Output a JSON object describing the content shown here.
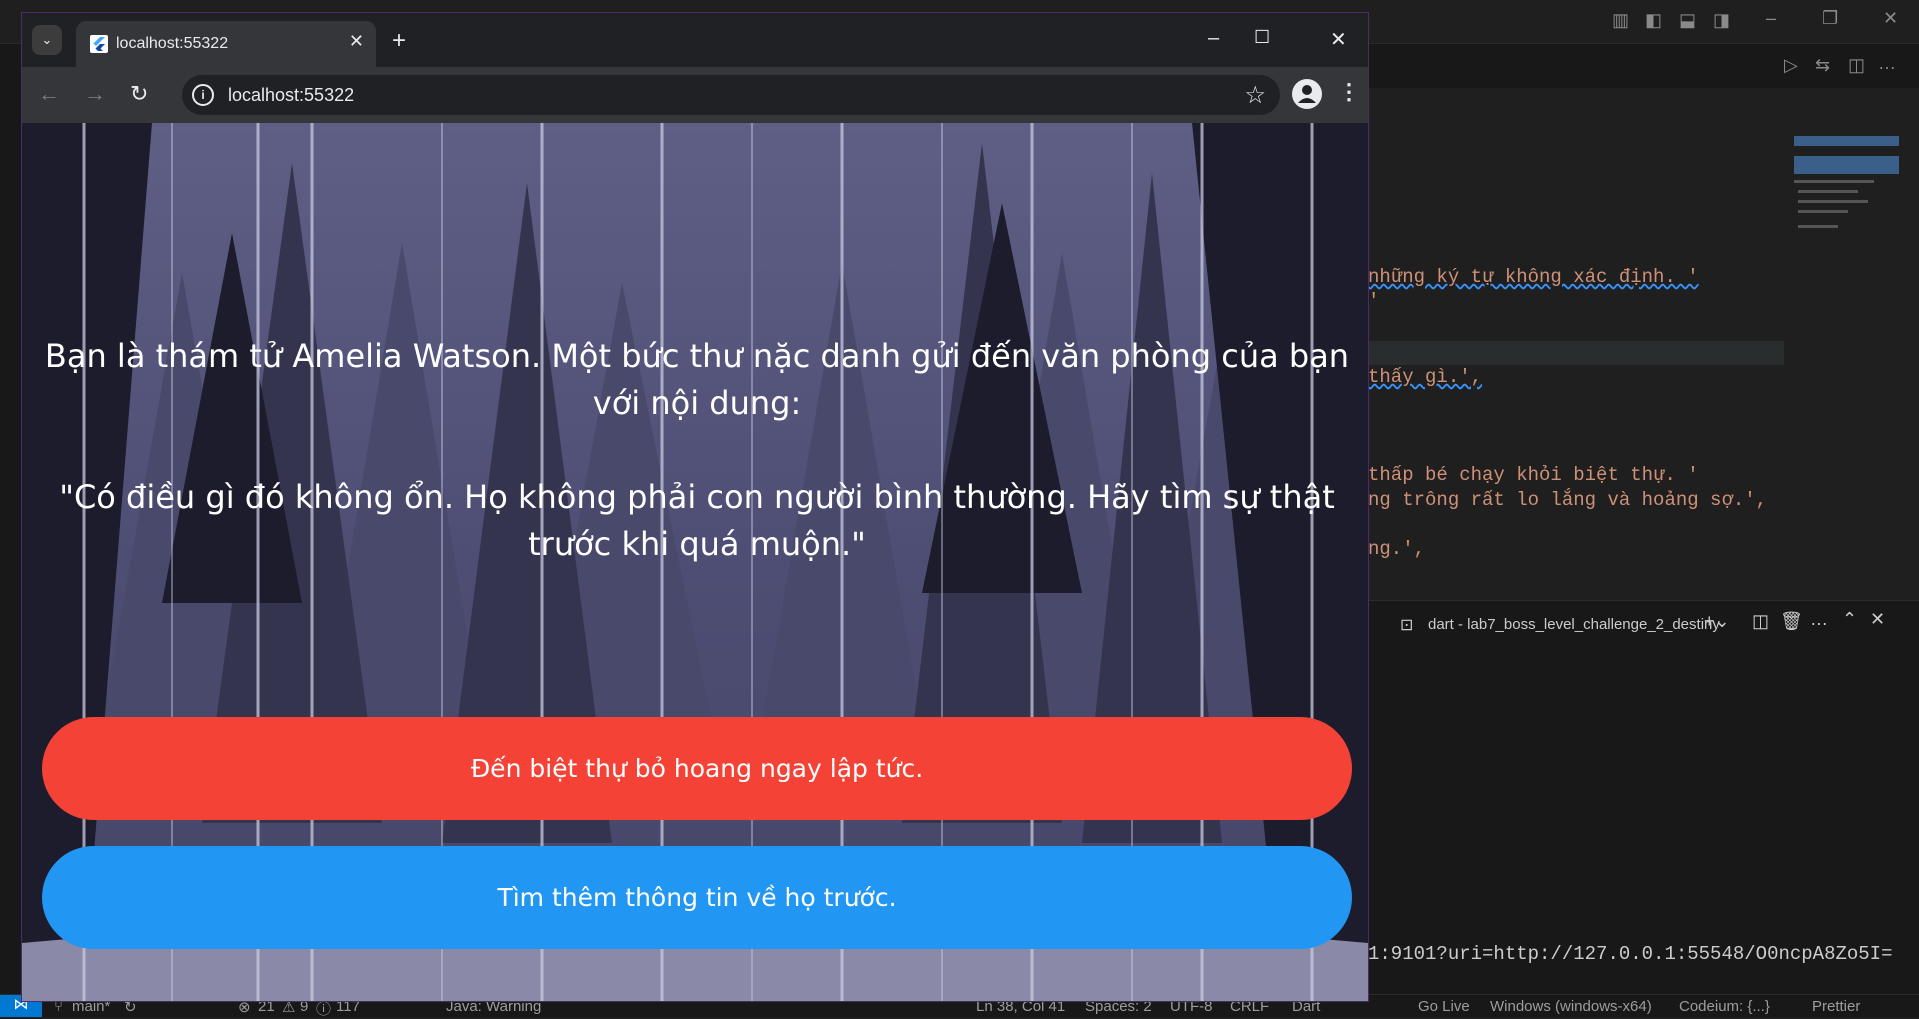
{
  "browser": {
    "tab_title": "localhost:55322",
    "url": "localhost:55322"
  },
  "story": {
    "paragraph_1": "Bạn là thám tử Amelia Watson. Một bức thư nặc danh gửi đến văn phòng của bạn với nội dung:",
    "paragraph_2": "\"Có điều gì đó không ổn. Họ không phải con người bình thường. Hãy tìm sự thật trước khi quá muộn.\""
  },
  "choices": [
    {
      "label": "Đến biệt thự bỏ hoang ngay lập tức.",
      "color": "#f44336"
    },
    {
      "label": "Tìm thêm thông tin về họ trước.",
      "color": "#2196f3"
    }
  ],
  "vscode": {
    "code_lines": [
      "những ký tự không xác định. '",
      "'",
      "thấy gì.',",
      "thấp bé chạy khỏi biệt thự. '",
      "ng trông rất lo lắng và hoảng sợ.',",
      "ng.',"
    ],
    "terminal_tab": "dart - lab7_boss_level_challenge_2_destiny",
    "terminal_output": "1:9101?uri=http://127.0.0.1:55548/O0ncpA8Zo5I=",
    "status": {
      "branch": "main*",
      "problems": "21",
      "warnings": "9",
      "infos": "117",
      "java": "Java: Warning",
      "position": "Ln 38, Col 41",
      "spaces": "Spaces: 2",
      "encoding": "UTF-8",
      "eol": "CRLF",
      "language": "Dart",
      "golive": "Go Live",
      "platform": "Windows (windows-x64)",
      "codeium": "Codeium: {...}",
      "prettier": "Prettier"
    }
  }
}
